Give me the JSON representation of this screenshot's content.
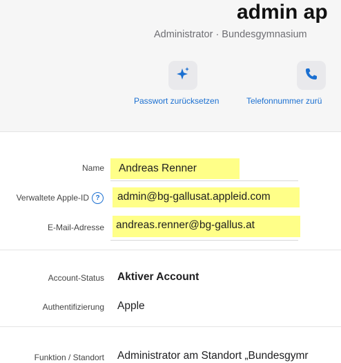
{
  "header": {
    "title": "admin ap",
    "subtitle": "Administrator · Bundesgymnasium",
    "actions": [
      {
        "icon": "sparkles-icon",
        "label": "Passwort zurücksetzen"
      },
      {
        "icon": "phone-icon",
        "label": "Telefonnummer zurü"
      }
    ]
  },
  "fields": {
    "name": {
      "label": "Name",
      "value": "Andreas Renner"
    },
    "apple_id": {
      "label": "Verwaltete Apple-ID",
      "help": "?",
      "value": "admin@bg-gallusat.appleid.com"
    },
    "email": {
      "label": "E-Mail-Adresse",
      "value": "andreas.renner@bg-gallus.at"
    },
    "account_status": {
      "label": "Account-Status",
      "value": "Aktiver Account"
    },
    "auth": {
      "label": "Authentifizierung",
      "value": "Apple"
    },
    "role": {
      "label": "Funktion / Standort",
      "value": "Administrator am Standort „Bundesgymr"
    }
  },
  "colors": {
    "accent": "#1a6fd1",
    "highlight": "#ffff88"
  }
}
